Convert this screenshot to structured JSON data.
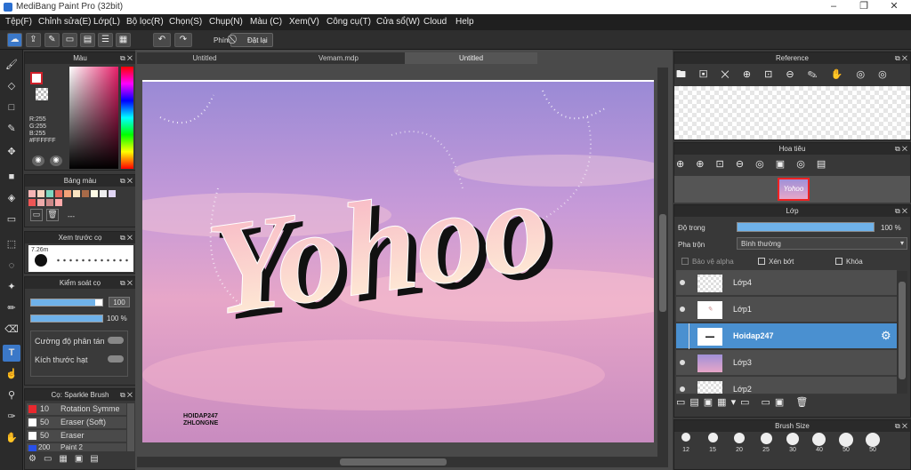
{
  "window": {
    "title": "MediBang Paint Pro (32bit)"
  },
  "menu": [
    "Tệp(F)",
    "Chỉnh sửa(E)",
    "Lớp(L)",
    "Bộ lọc(R)",
    "Chọn(S)",
    "Chụp(N)",
    "Màu (C)",
    "Xem(V)",
    "Công cụ(T)",
    "Cửa sổ(W)",
    "Cloud",
    "Help"
  ],
  "toolbar": {
    "key_label": "Phím",
    "reset_label": "Đặt lại"
  },
  "tabs": [
    "Untitled",
    "Vemam.mdp",
    "Untitled"
  ],
  "color_panel": {
    "title": "Màu",
    "r": "R:255",
    "g": "G:255",
    "b": "B:255",
    "hex": "#FFFFFF"
  },
  "palette_panel": {
    "title": "Bảng màu",
    "dash": "---"
  },
  "brush_preview": {
    "title": "Xem trước cọ",
    "size": "7.26m"
  },
  "brush_control": {
    "title": "Kiểm soát cọ",
    "size_value": "100",
    "opacity_value": "100 %",
    "scatter_label": "Cường độ phân tán",
    "particle_label": "Kích thước hạt"
  },
  "brush_list": {
    "title": "Cọ: Sparkle Brush",
    "items": [
      {
        "size": "10",
        "name": "Rotation Symme",
        "color": "#e8282e"
      },
      {
        "size": "50",
        "name": "Eraser (Soft)",
        "color": "#ffffff"
      },
      {
        "size": "50",
        "name": "Eraser",
        "color": "#ffffff"
      },
      {
        "size": "200",
        "name": "Paint 2",
        "color": "#2850e8"
      }
    ]
  },
  "artwork": {
    "text": "Yohoo",
    "watermark_line1": "HOIDAP247",
    "watermark_line2": "ZHLONGNE"
  },
  "reference_panel": {
    "title": "Reference"
  },
  "navigator_panel": {
    "title": "Hoa tiêu",
    "thumb_text": "Yohoo"
  },
  "layer_panel": {
    "title": "Lớp",
    "opacity_label": "Độ trong",
    "opacity_value": "100 %",
    "opacity_fraction": 1.0,
    "blend_label": "Pha trộn",
    "blend_value": "Bình thường",
    "protect_alpha": "Bảo vệ alpha",
    "clipping": "Xén bớt",
    "lock": "Khóa",
    "layers": [
      {
        "name": "Lớp4",
        "selected": false
      },
      {
        "name": "Lớp1",
        "selected": false
      },
      {
        "name": "Hoidap247",
        "selected": true
      },
      {
        "name": "Lớp3",
        "selected": false
      },
      {
        "name": "Lớp2",
        "selected": false
      }
    ]
  },
  "brush_size_panel": {
    "title": "Brush Size",
    "sizes": [
      "12",
      "15",
      "20",
      "25",
      "30",
      "40",
      "50",
      "50"
    ]
  }
}
